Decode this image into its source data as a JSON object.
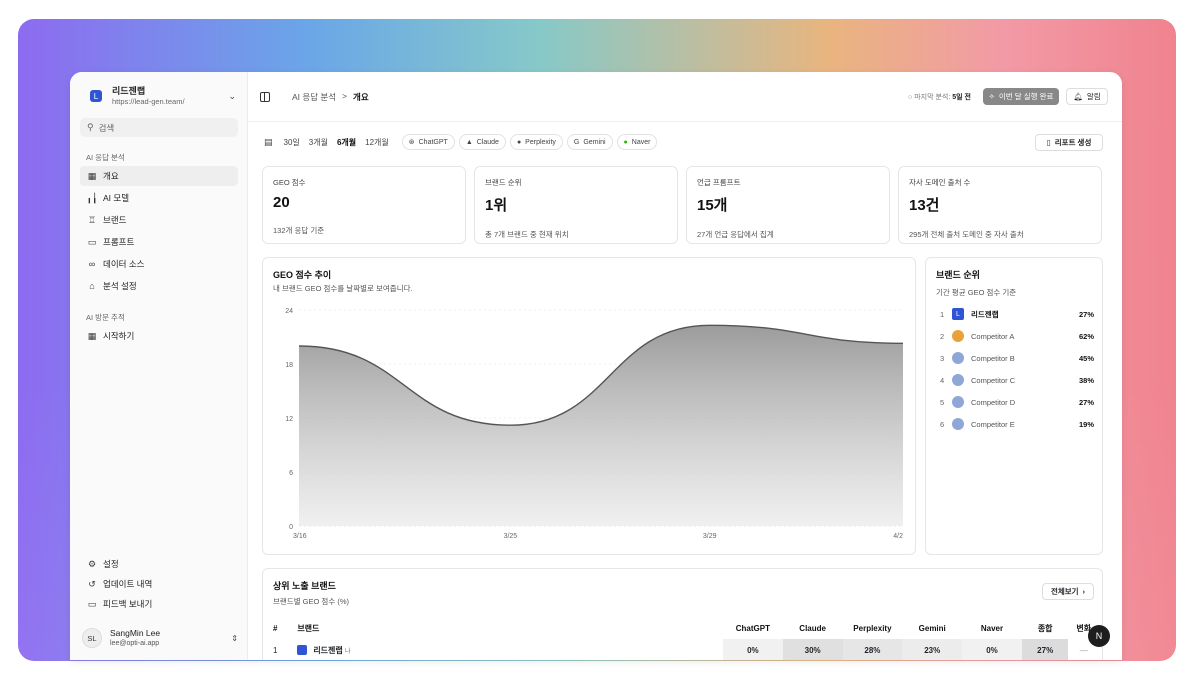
{
  "workspace": {
    "logo": "L",
    "name": "리드젠랩",
    "url": "https://lead-gen.team/"
  },
  "search": {
    "placeholder": "검색",
    "icon": "search-icon"
  },
  "sidebar": {
    "section1_title": "AI 응답 분석",
    "items": [
      {
        "label": "개요",
        "icon": "grid-icon"
      },
      {
        "label": "AI 모델",
        "icon": "bar-chart-icon"
      },
      {
        "label": "브랜드",
        "icon": "trophy-icon"
      },
      {
        "label": "프롬프트",
        "icon": "message-icon"
      },
      {
        "label": "데이터 소스",
        "icon": "link-icon"
      },
      {
        "label": "분석 설정",
        "icon": "settings-icon"
      }
    ],
    "section2_title": "AI 방문 추적",
    "items2": [
      {
        "label": "시작하기",
        "icon": "grid-icon"
      }
    ],
    "footer_items": [
      {
        "label": "설정",
        "icon": "gear-icon"
      },
      {
        "label": "업데이트 내역",
        "icon": "history-icon"
      },
      {
        "label": "피드백 보내기",
        "icon": "message-icon"
      }
    ]
  },
  "user": {
    "initials": "SL",
    "name": "SangMin Lee",
    "email": "lee@opti-ai.app"
  },
  "header": {
    "breadcrumb_parent": "AI 응답 분석",
    "breadcrumb_sep": ">",
    "breadcrumb_current": "개요",
    "last_analysis_label": "마지막 분석:",
    "last_analysis_value": "5일 전",
    "run_button": "이번 달 실행 완료",
    "alert_button": "알림"
  },
  "filters": {
    "periods": [
      "30일",
      "3개월",
      "6개월",
      "12개월"
    ],
    "selected_period": "6개월",
    "models": [
      "ChatGPT",
      "Claude",
      "Perplexity",
      "Gemini",
      "Naver"
    ],
    "report_button": "리포트 생성"
  },
  "kpis": [
    {
      "label": "GEO 점수",
      "value": "20",
      "sub": "132개 응답 기준"
    },
    {
      "label": "브랜드 순위",
      "value": "1위",
      "sub": "총 7개 브랜드 중 현재 위치"
    },
    {
      "label": "언급 프롬프트",
      "value": "15개",
      "sub": "27개 언급 응답에서 집계"
    },
    {
      "label": "자사 도메인 출처 수",
      "value": "13건",
      "sub": "295개 전체 출처 도메인 중 자사 출처"
    }
  ],
  "trend": {
    "title": "GEO 점수 추이",
    "subtitle": "내 브랜드 GEO 점수를 날짜별로 보여줍니다."
  },
  "chart_data": {
    "type": "area",
    "x": [
      "3/16",
      "3/25",
      "3/29",
      "4/2"
    ],
    "x_positions": [
      0,
      0.35,
      0.68,
      1.0
    ],
    "y": [
      20,
      11.2,
      22.3,
      20.3
    ],
    "yticks": [
      0,
      6,
      12,
      18,
      24
    ],
    "ylim": [
      0,
      24
    ],
    "color": "#555555"
  },
  "ranking": {
    "title": "브랜드 순위",
    "subtitle": "기간 평균 GEO 점수 기준",
    "rows": [
      {
        "rank": "1",
        "name": "리드젠랩",
        "value": "27%",
        "color": "#2f55d4",
        "own": true
      },
      {
        "rank": "2",
        "name": "Competitor A",
        "value": "62%",
        "color": "#e9a23b",
        "own": false
      },
      {
        "rank": "3",
        "name": "Competitor B",
        "value": "45%",
        "color": "#8fa7d6",
        "own": false
      },
      {
        "rank": "4",
        "name": "Competitor C",
        "value": "38%",
        "color": "#8fa7d6",
        "own": false
      },
      {
        "rank": "5",
        "name": "Competitor D",
        "value": "27%",
        "color": "#8fa7d6",
        "own": false
      },
      {
        "rank": "6",
        "name": "Competitor E",
        "value": "19%",
        "color": "#8fa7d6",
        "own": false
      }
    ]
  },
  "top_brands": {
    "title": "상위 노출 브랜드",
    "subtitle": "브랜드별 GEO 점수 (%)",
    "view_all": "전체보기",
    "columns": [
      "#",
      "브랜드",
      "ChatGPT",
      "Claude",
      "Perplexity",
      "Gemini",
      "Naver",
      "종합",
      "변화"
    ],
    "row1": {
      "rank": "1",
      "brand": "리드젠랩",
      "tag": "나",
      "chatgpt": "0%",
      "claude": "30%",
      "perplexity": "28%",
      "gemini": "23%",
      "naver": "0%",
      "total": "27%",
      "change": "—"
    }
  },
  "fab": "N"
}
